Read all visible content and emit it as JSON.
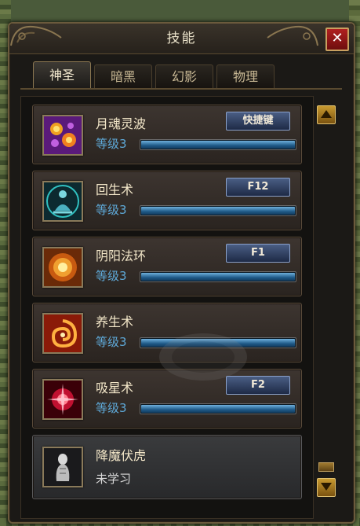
{
  "window": {
    "title": "技能",
    "close_label": "✕"
  },
  "tabs": [
    {
      "label": "神圣",
      "active": true
    },
    {
      "label": "暗黑",
      "active": false
    },
    {
      "label": "幻影",
      "active": false
    },
    {
      "label": "物理",
      "active": false
    }
  ],
  "skills": [
    {
      "name": "月魂灵波",
      "level": "等级3",
      "progress": 1.0,
      "hotkey": "快捷键",
      "icon": "purple-orbs-icon"
    },
    {
      "name": "回生术",
      "level": "等级3",
      "progress": 1.0,
      "hotkey": "F12",
      "icon": "meditating-monk-icon"
    },
    {
      "name": "阴阳法环",
      "level": "等级3",
      "progress": 1.0,
      "hotkey": "F1",
      "icon": "golden-sun-icon"
    },
    {
      "name": "养生术",
      "level": "等级3",
      "progress": 1.0,
      "hotkey": "",
      "icon": "fire-swirl-icon"
    },
    {
      "name": "吸星术",
      "level": "等级3",
      "progress": 1.0,
      "hotkey": "F2",
      "icon": "red-star-icon"
    },
    {
      "name": "降魔伏虎",
      "status": "未学习",
      "icon": "white-statue-icon"
    }
  ],
  "colors": {
    "accent_gold": "#c8a060",
    "level_blue": "#5ea9d8",
    "bar_blue": "#1f5a88",
    "close_red": "#b02020"
  }
}
